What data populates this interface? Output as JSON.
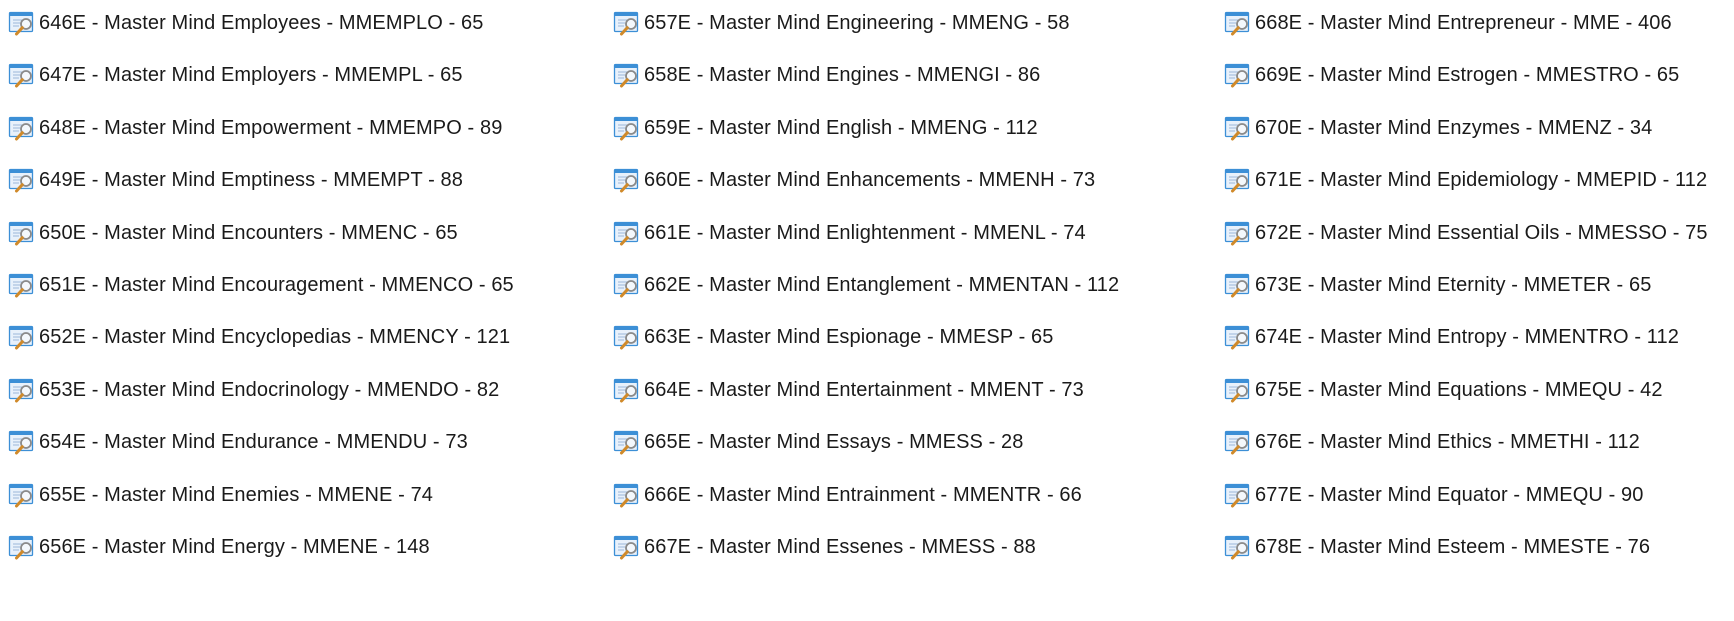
{
  "columns": [
    {
      "items": [
        "646E - Master Mind Employees - MMEMPLO - 65",
        "647E - Master Mind Employers - MMEMPL - 65",
        "648E - Master Mind Empowerment - MMEMPO - 89",
        "649E - Master Mind Emptiness - MMEMPT - 88",
        "650E - Master Mind Encounters - MMENC - 65",
        "651E - Master Mind Encouragement - MMENCO - 65",
        "652E - Master Mind Encyclopedias - MMENCY - 121",
        "653E - Master Mind Endocrinology - MMENDO - 82",
        "654E - Master Mind Endurance - MMENDU - 73",
        "655E - Master Mind Enemies - MMENE - 74",
        "656E - Master Mind Energy - MMENE - 148"
      ]
    },
    {
      "items": [
        "657E - Master Mind Engineering - MMENG - 58",
        "658E - Master Mind Engines - MMENGI - 86",
        "659E - Master Mind English - MMENG - 112",
        "660E - Master Mind Enhancements - MMENH - 73",
        "661E - Master Mind Enlightenment - MMENL - 74",
        "662E - Master Mind Entanglement - MMENTAN - 112",
        "663E - Master Mind Espionage - MMESP - 65",
        "664E - Master Mind Entertainment - MMENT - 73",
        "665E - Master Mind Essays - MMESS - 28",
        "666E - Master Mind Entrainment - MMENTR - 66",
        "667E - Master Mind Essenes - MMESS - 88"
      ]
    },
    {
      "items": [
        "668E - Master Mind Entrepreneur - MME - 406",
        "669E - Master Mind Estrogen - MMESTRO - 65",
        "670E - Master Mind Enzymes - MMENZ - 34",
        "671E - Master Mind Epidemiology - MMEPID - 112",
        "672E - Master Mind Essential Oils - MMESSO - 75",
        "673E - Master Mind Eternity - MMETER - 65",
        "674E - Master Mind Entropy - MMENTRO - 112",
        "675E - Master Mind Equations - MMEQU - 42",
        "676E - Master Mind Ethics - MMETHI - 112",
        "677E - Master Mind Equator - MMEQU - 90",
        "678E - Master Mind Esteem - MMESTE - 76"
      ]
    }
  ],
  "icon": "search-results-file-icon",
  "colors": {
    "text": "#1a1a1a",
    "icon_window": "#3c8fd6",
    "icon_page": "#ffffff",
    "icon_lens": "#8a8a8a"
  }
}
